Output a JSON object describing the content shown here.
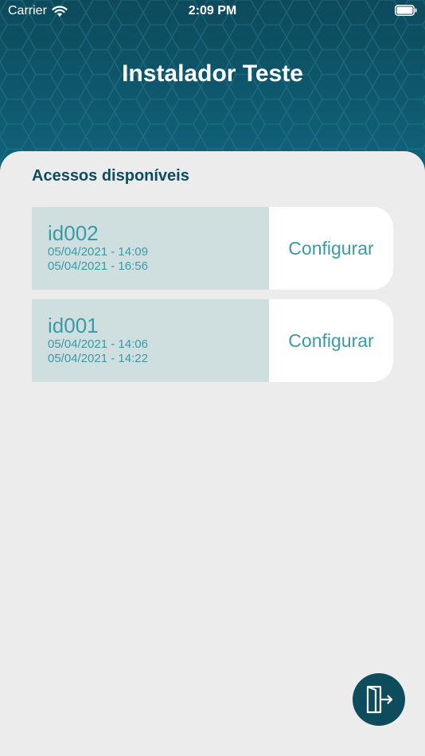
{
  "status_bar": {
    "carrier": "Carrier",
    "time": "2:09 PM"
  },
  "header": {
    "title": "Instalador Teste"
  },
  "section": {
    "title": "Acessos disponíveis"
  },
  "accesses": [
    {
      "id": "id002",
      "start": "05/04/2021 - 14:09",
      "end": "05/04/2021 - 16:56",
      "action_label": "Configurar"
    },
    {
      "id": "id001",
      "start": "05/04/2021 - 14:06",
      "end": "05/04/2021 - 14:22",
      "action_label": "Configurar"
    }
  ],
  "icons": {
    "wifi": "wifi-icon",
    "battery": "battery-icon",
    "logout": "logout-door-icon"
  },
  "colors": {
    "primary_dark": "#0e4b5d",
    "accent": "#3a9aa6",
    "card_info_bg": "#cfdfe0",
    "background": "#ececec"
  }
}
